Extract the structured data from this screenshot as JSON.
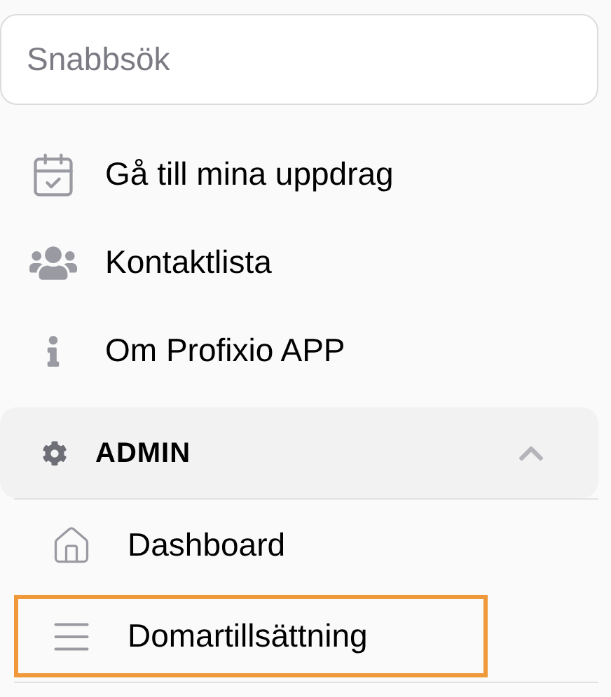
{
  "search": {
    "placeholder": "Snabbsök"
  },
  "menu": [
    {
      "label": "Gå till mina uppdrag"
    },
    {
      "label": "Kontaktlista"
    },
    {
      "label": "Om Profixio APP"
    }
  ],
  "admin": {
    "label": "ADMIN",
    "expanded": true,
    "items": [
      {
        "label": "Dashboard",
        "selected": false
      },
      {
        "label": "Domartillsättning",
        "selected": true
      }
    ]
  }
}
